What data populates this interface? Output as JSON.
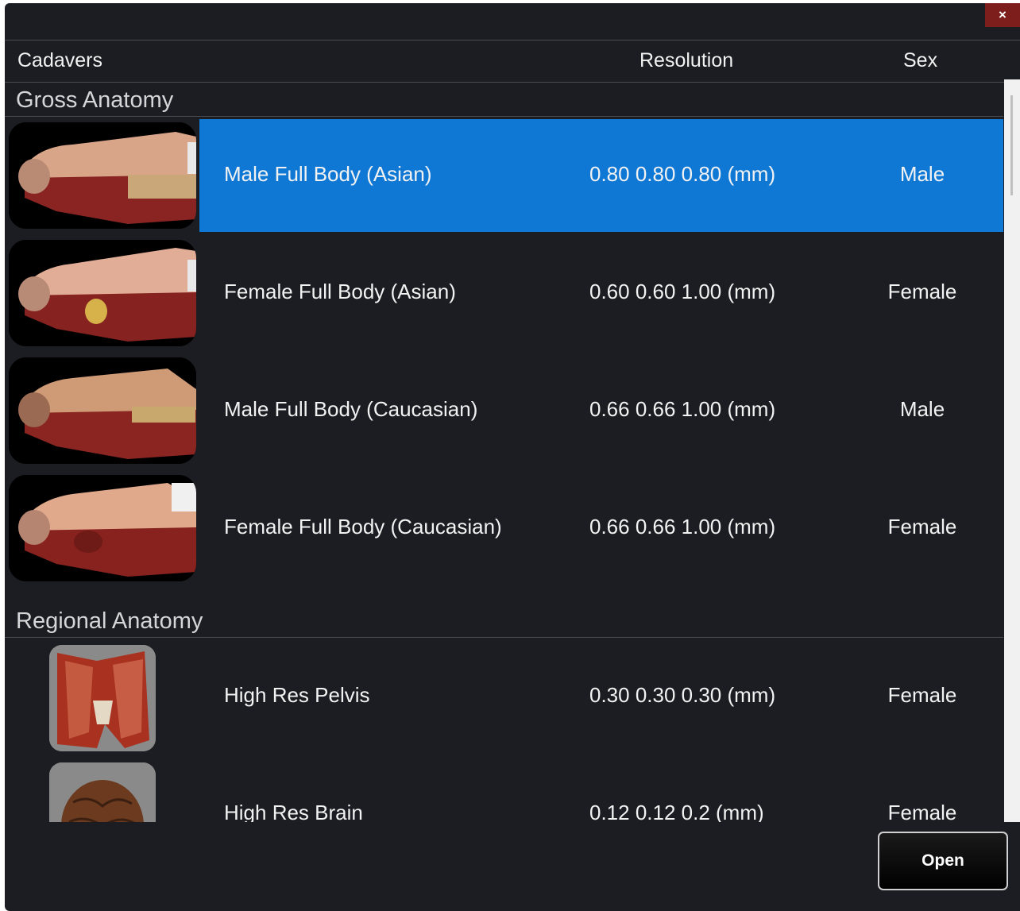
{
  "window": {
    "close_label": "×",
    "close_color": "#7e1e1c",
    "accent": "#0f78d5"
  },
  "header": {
    "cadavers": "Cadavers",
    "resolution": "Resolution",
    "sex": "Sex"
  },
  "sections": {
    "gross": {
      "title": "Gross Anatomy",
      "rows": [
        {
          "name": "Male Full Body (Asian)",
          "resolution": "0.80 0.80 0.80 (mm)",
          "sex": "Male",
          "selected": true
        },
        {
          "name": "Female Full Body (Asian)",
          "resolution": "0.60 0.60 1.00 (mm)",
          "sex": "Female"
        },
        {
          "name": "Male Full Body (Caucasian)",
          "resolution": "0.66 0.66 1.00 (mm)",
          "sex": "Male"
        },
        {
          "name": "Female Full Body (Caucasian)",
          "resolution": "0.66 0.66 1.00 (mm)",
          "sex": "Female"
        }
      ]
    },
    "regional": {
      "title": "Regional Anatomy",
      "rows": [
        {
          "name": "High Res Pelvis",
          "resolution": "0.30 0.30 0.30 (mm)",
          "sex": "Female"
        },
        {
          "name": "High Res Brain",
          "resolution": "0.12 0.12 0.2 (mm)",
          "sex": "Female"
        }
      ]
    }
  },
  "footer": {
    "open_label": "Open"
  }
}
